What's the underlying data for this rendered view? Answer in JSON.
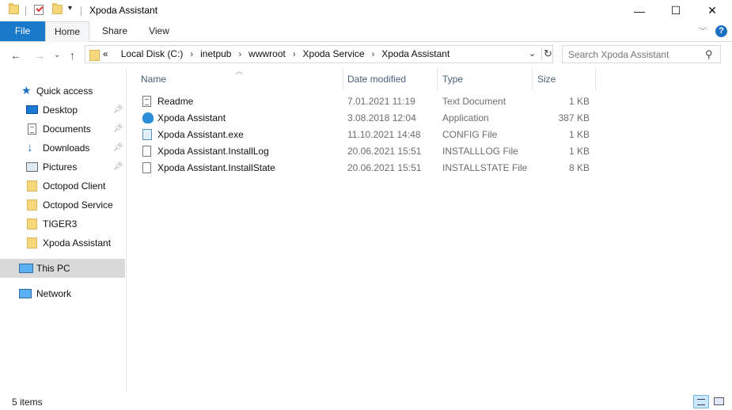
{
  "window": {
    "title": "Xpoda Assistant",
    "minimize_label": "—",
    "maximize_label": "☐",
    "close_label": "✕"
  },
  "ribbon": {
    "tabs": [
      {
        "label": "File"
      },
      {
        "label": "Home"
      },
      {
        "label": "Share"
      },
      {
        "label": "View"
      }
    ],
    "help_label": "?"
  },
  "address": {
    "overflow": "«",
    "crumbs": [
      "Local Disk (C:)",
      "inetpub",
      "wwwroot",
      "Xpoda Service",
      "Xpoda Assistant"
    ]
  },
  "search": {
    "placeholder": "Search Xpoda Assistant"
  },
  "navpane": {
    "items": [
      {
        "label": "Quick access",
        "icon": "star-icon"
      },
      {
        "label": "Desktop",
        "icon": "desktop-icon",
        "pinned": true
      },
      {
        "label": "Documents",
        "icon": "documents-icon",
        "pinned": true
      },
      {
        "label": "Downloads",
        "icon": "download-icon",
        "pinned": true
      },
      {
        "label": "Pictures",
        "icon": "pictures-icon",
        "pinned": true
      },
      {
        "label": "Octopod Client",
        "icon": "folder-icon"
      },
      {
        "label": "Octopod Service",
        "icon": "folder-icon"
      },
      {
        "label": "TIGER3",
        "icon": "folder-icon"
      },
      {
        "label": "Xpoda Assistant",
        "icon": "folder-icon"
      },
      {
        "label": "This PC",
        "icon": "this-pc-icon"
      },
      {
        "label": "Network",
        "icon": "network-icon"
      }
    ]
  },
  "columns": {
    "name": "Name",
    "date": "Date modified",
    "type": "Type",
    "size": "Size"
  },
  "files": [
    {
      "name": "Readme",
      "date": "7.01.2021 11:19",
      "type": "Text Document",
      "size": "1 KB",
      "icon": "text-document-icon"
    },
    {
      "name": "Xpoda Assistant",
      "date": "3.08.2018 12:04",
      "type": "Application",
      "size": "387 KB",
      "icon": "application-icon"
    },
    {
      "name": "Xpoda Assistant.exe",
      "date": "11.10.2021 14:48",
      "type": "CONFIG File",
      "size": "1 KB",
      "icon": "config-file-icon"
    },
    {
      "name": "Xpoda Assistant.InstallLog",
      "date": "20.06.2021 15:51",
      "type": "INSTALLLOG File",
      "size": "1 KB",
      "icon": "file-icon"
    },
    {
      "name": "Xpoda Assistant.InstallState",
      "date": "20.06.2021 15:51",
      "type": "INSTALLSTATE File",
      "size": "8 KB",
      "icon": "file-icon"
    }
  ],
  "status": {
    "item_count": "5 items"
  }
}
